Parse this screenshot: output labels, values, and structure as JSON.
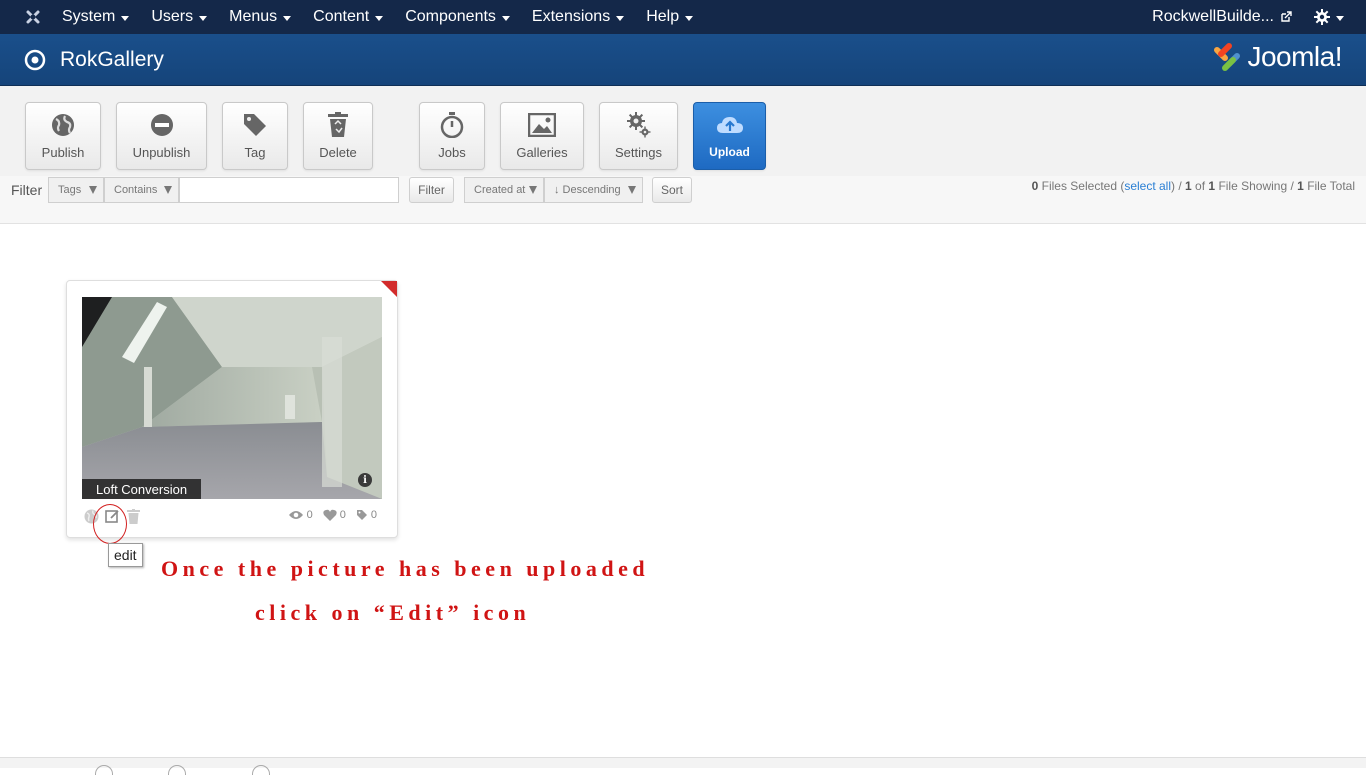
{
  "topbar": {
    "menu": [
      {
        "label": "System"
      },
      {
        "label": "Users"
      },
      {
        "label": "Menus"
      },
      {
        "label": "Content"
      },
      {
        "label": "Components"
      },
      {
        "label": "Extensions"
      },
      {
        "label": "Help"
      }
    ],
    "site_name": "RockwellBuilde...",
    "bg_color": "#142849"
  },
  "header": {
    "title": "RokGallery",
    "logo_text": "Joomla!",
    "bg_color": "#1a4f8b"
  },
  "toolbar": {
    "buttons": [
      {
        "label": "Publish",
        "icon": "globe-icon"
      },
      {
        "label": "Unpublish",
        "icon": "minus-circle-icon"
      },
      {
        "label": "Tag",
        "icon": "tag-icon"
      },
      {
        "label": "Delete",
        "icon": "trash-icon"
      },
      {
        "label": "Jobs",
        "icon": "stopwatch-icon"
      },
      {
        "label": "Galleries",
        "icon": "image-icon"
      },
      {
        "label": "Settings",
        "icon": "gear-icon"
      },
      {
        "label": "Upload",
        "icon": "cloud-upload-icon"
      }
    ],
    "upload_color": "#2a7ad0"
  },
  "filterbar": {
    "label": "Filter",
    "field_select": "Tags",
    "operator_select": "Contains",
    "input_value": "",
    "filter_button": "Filter",
    "sort_field": "Created at",
    "sort_order": "↓ Descending",
    "sort_button": "Sort",
    "status": {
      "selected_count": "0",
      "selected_text": "Files Selected (",
      "select_all": "select all",
      "showing_prefix": ") / ",
      "showing_count": "1",
      "of_text": "of",
      "total_showing": "1",
      "showing_text": "File Showing /",
      "total_count": "1",
      "total_text": "File Total"
    }
  },
  "gallery": {
    "items": [
      {
        "caption": "Loft Conversion",
        "views": "0",
        "loves": "0",
        "tags": "0"
      }
    ]
  },
  "annotation": {
    "tooltip": "edit",
    "line1": "Once the picture has been uploaded",
    "line2": "click on “Edit” icon",
    "color": "#d01414"
  }
}
